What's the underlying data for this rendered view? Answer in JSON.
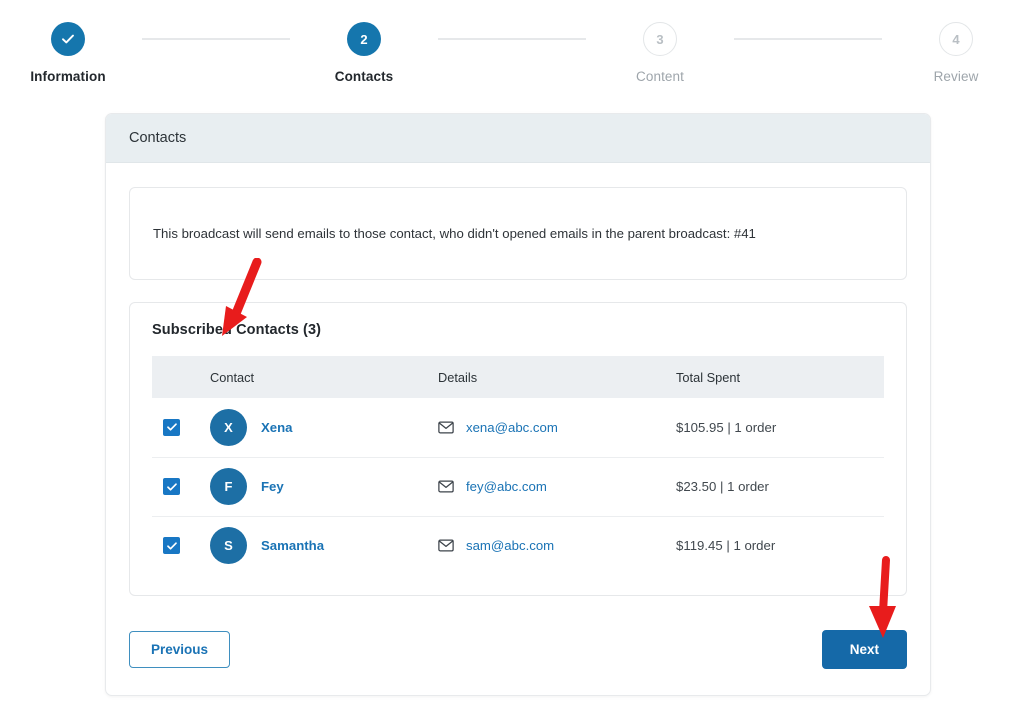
{
  "stepper": {
    "steps": [
      {
        "number": "1",
        "label": "Information",
        "state": "done",
        "icon": "check-icon"
      },
      {
        "number": "2",
        "label": "Contacts",
        "state": "active",
        "icon": ""
      },
      {
        "number": "3",
        "label": "Content",
        "state": "todo",
        "icon": ""
      },
      {
        "number": "4",
        "label": "Review",
        "state": "todo",
        "icon": ""
      }
    ]
  },
  "card": {
    "header_title": "Contacts",
    "notice": "This broadcast will send emails to those contact, who didn't opened emails in the parent broadcast: #41",
    "panel_title": "Subscribed Contacts (3)",
    "table": {
      "columns": [
        "",
        "Contact",
        "Details",
        "Total Spent"
      ],
      "rows": [
        {
          "checked": true,
          "initial": "X",
          "name": "Xena",
          "email": "xena@abc.com",
          "total_spent": "$105.95 | 1 order"
        },
        {
          "checked": true,
          "initial": "F",
          "name": "Fey",
          "email": "fey@abc.com",
          "total_spent": "$23.50 | 1 order"
        },
        {
          "checked": true,
          "initial": "S",
          "name": "Samantha",
          "email": "sam@abc.com",
          "total_spent": "$119.45 | 1 order"
        }
      ]
    },
    "buttons": {
      "previous": "Previous",
      "next": "Next"
    }
  },
  "annotations": {
    "arrow_1": "red-arrow-icon",
    "arrow_2": "red-arrow-icon"
  },
  "colors": {
    "accent_blue": "#1576ad",
    "link_blue": "#1a73b5",
    "next_button": "#1569a8",
    "checkbox_blue": "#1877c4",
    "avatar_blue": "#1d6fa5",
    "header_band": "#e8eef1",
    "table_head": "#eceff2",
    "annotation_red": "#e81c1c"
  }
}
